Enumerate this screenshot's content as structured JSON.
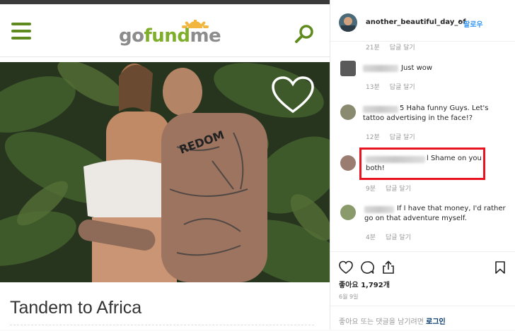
{
  "gofundme": {
    "logo_part1": "go",
    "logo_part2": "fund",
    "logo_part3": "me",
    "campaign_title": "Tandem to Africa",
    "colors": {
      "brand": "#7fae2b",
      "icon": "#5f8a1e"
    }
  },
  "instagram": {
    "username": "another_beautiful_day_of",
    "dot": "•",
    "follow_label": "팔로우",
    "comments": [
      {
        "text": "",
        "time": "21분",
        "reply": "답글 달기"
      },
      {
        "text": "Just wow",
        "time": "13분",
        "reply": "답글 달기"
      },
      {
        "text": "5 Haha funny Guys. Let's tattoo advertising in the face!?",
        "time": "12분",
        "reply": "답글 달기"
      },
      {
        "text": "l Shame on you both!",
        "time": "9분",
        "reply": "답글 달기",
        "highlighted": true
      },
      {
        "text": "If I have that money, I'd rather go on that adventure myself.",
        "time": "4분",
        "reply": "답글 달기"
      }
    ],
    "likes": "좋아요 1,792개",
    "date": "6월 9일",
    "login_prompt": "좋아요 또는 댓글을 남기려면",
    "login_link": "로그인",
    "highlight_color": "#e8141f",
    "follow_color": "#3897f0"
  }
}
